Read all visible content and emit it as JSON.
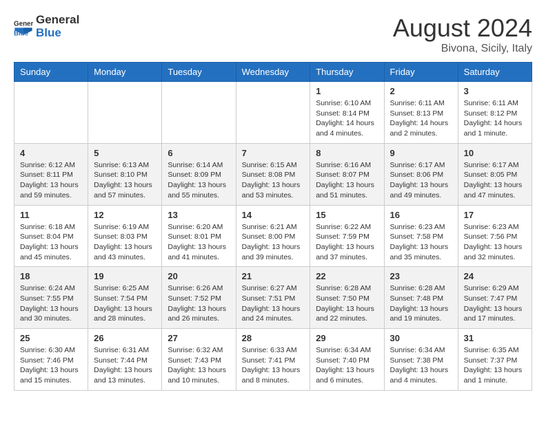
{
  "header": {
    "logo_general": "General",
    "logo_blue": "Blue",
    "month_year": "August 2024",
    "location": "Bivona, Sicily, Italy"
  },
  "weekdays": [
    "Sunday",
    "Monday",
    "Tuesday",
    "Wednesday",
    "Thursday",
    "Friday",
    "Saturday"
  ],
  "weeks": [
    [
      {
        "day": "",
        "info": ""
      },
      {
        "day": "",
        "info": ""
      },
      {
        "day": "",
        "info": ""
      },
      {
        "day": "",
        "info": ""
      },
      {
        "day": "1",
        "info": "Sunrise: 6:10 AM\nSunset: 8:14 PM\nDaylight: 14 hours\nand 4 minutes."
      },
      {
        "day": "2",
        "info": "Sunrise: 6:11 AM\nSunset: 8:13 PM\nDaylight: 14 hours\nand 2 minutes."
      },
      {
        "day": "3",
        "info": "Sunrise: 6:11 AM\nSunset: 8:12 PM\nDaylight: 14 hours\nand 1 minute."
      }
    ],
    [
      {
        "day": "4",
        "info": "Sunrise: 6:12 AM\nSunset: 8:11 PM\nDaylight: 13 hours\nand 59 minutes."
      },
      {
        "day": "5",
        "info": "Sunrise: 6:13 AM\nSunset: 8:10 PM\nDaylight: 13 hours\nand 57 minutes."
      },
      {
        "day": "6",
        "info": "Sunrise: 6:14 AM\nSunset: 8:09 PM\nDaylight: 13 hours\nand 55 minutes."
      },
      {
        "day": "7",
        "info": "Sunrise: 6:15 AM\nSunset: 8:08 PM\nDaylight: 13 hours\nand 53 minutes."
      },
      {
        "day": "8",
        "info": "Sunrise: 6:16 AM\nSunset: 8:07 PM\nDaylight: 13 hours\nand 51 minutes."
      },
      {
        "day": "9",
        "info": "Sunrise: 6:17 AM\nSunset: 8:06 PM\nDaylight: 13 hours\nand 49 minutes."
      },
      {
        "day": "10",
        "info": "Sunrise: 6:17 AM\nSunset: 8:05 PM\nDaylight: 13 hours\nand 47 minutes."
      }
    ],
    [
      {
        "day": "11",
        "info": "Sunrise: 6:18 AM\nSunset: 8:04 PM\nDaylight: 13 hours\nand 45 minutes."
      },
      {
        "day": "12",
        "info": "Sunrise: 6:19 AM\nSunset: 8:03 PM\nDaylight: 13 hours\nand 43 minutes."
      },
      {
        "day": "13",
        "info": "Sunrise: 6:20 AM\nSunset: 8:01 PM\nDaylight: 13 hours\nand 41 minutes."
      },
      {
        "day": "14",
        "info": "Sunrise: 6:21 AM\nSunset: 8:00 PM\nDaylight: 13 hours\nand 39 minutes."
      },
      {
        "day": "15",
        "info": "Sunrise: 6:22 AM\nSunset: 7:59 PM\nDaylight: 13 hours\nand 37 minutes."
      },
      {
        "day": "16",
        "info": "Sunrise: 6:23 AM\nSunset: 7:58 PM\nDaylight: 13 hours\nand 35 minutes."
      },
      {
        "day": "17",
        "info": "Sunrise: 6:23 AM\nSunset: 7:56 PM\nDaylight: 13 hours\nand 32 minutes."
      }
    ],
    [
      {
        "day": "18",
        "info": "Sunrise: 6:24 AM\nSunset: 7:55 PM\nDaylight: 13 hours\nand 30 minutes."
      },
      {
        "day": "19",
        "info": "Sunrise: 6:25 AM\nSunset: 7:54 PM\nDaylight: 13 hours\nand 28 minutes."
      },
      {
        "day": "20",
        "info": "Sunrise: 6:26 AM\nSunset: 7:52 PM\nDaylight: 13 hours\nand 26 minutes."
      },
      {
        "day": "21",
        "info": "Sunrise: 6:27 AM\nSunset: 7:51 PM\nDaylight: 13 hours\nand 24 minutes."
      },
      {
        "day": "22",
        "info": "Sunrise: 6:28 AM\nSunset: 7:50 PM\nDaylight: 13 hours\nand 22 minutes."
      },
      {
        "day": "23",
        "info": "Sunrise: 6:28 AM\nSunset: 7:48 PM\nDaylight: 13 hours\nand 19 minutes."
      },
      {
        "day": "24",
        "info": "Sunrise: 6:29 AM\nSunset: 7:47 PM\nDaylight: 13 hours\nand 17 minutes."
      }
    ],
    [
      {
        "day": "25",
        "info": "Sunrise: 6:30 AM\nSunset: 7:46 PM\nDaylight: 13 hours\nand 15 minutes."
      },
      {
        "day": "26",
        "info": "Sunrise: 6:31 AM\nSunset: 7:44 PM\nDaylight: 13 hours\nand 13 minutes."
      },
      {
        "day": "27",
        "info": "Sunrise: 6:32 AM\nSunset: 7:43 PM\nDaylight: 13 hours\nand 10 minutes."
      },
      {
        "day": "28",
        "info": "Sunrise: 6:33 AM\nSunset: 7:41 PM\nDaylight: 13 hours\nand 8 minutes."
      },
      {
        "day": "29",
        "info": "Sunrise: 6:34 AM\nSunset: 7:40 PM\nDaylight: 13 hours\nand 6 minutes."
      },
      {
        "day": "30",
        "info": "Sunrise: 6:34 AM\nSunset: 7:38 PM\nDaylight: 13 hours\nand 4 minutes."
      },
      {
        "day": "31",
        "info": "Sunrise: 6:35 AM\nSunset: 7:37 PM\nDaylight: 13 hours\nand 1 minute."
      }
    ]
  ]
}
